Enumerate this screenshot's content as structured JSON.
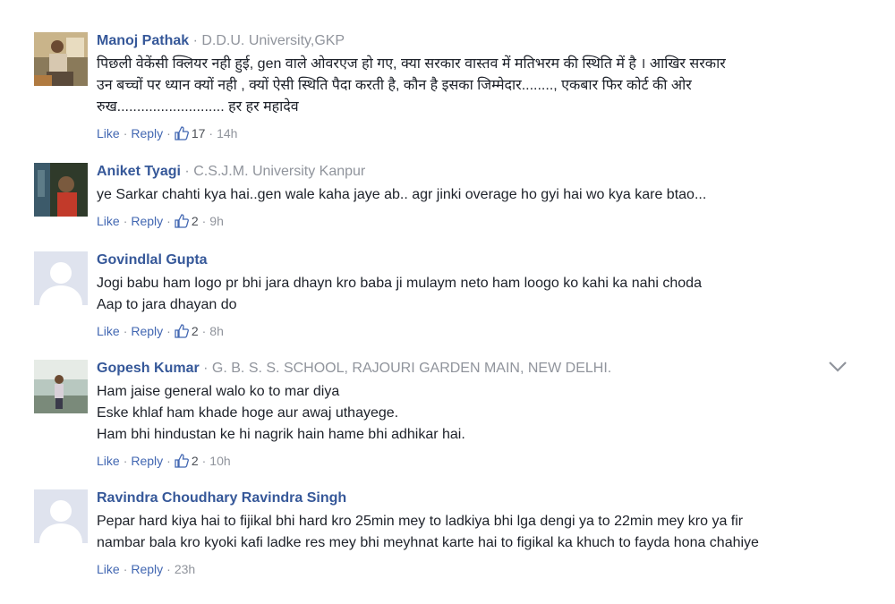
{
  "comments": [
    {
      "name": "Manoj Pathak",
      "subtitle": "D.D.U. University,GKP",
      "lines": [
        "पिछली वेकेंसी क्लियर नही हुई, gen वाले ओवरएज हो गए, क्या सरकार वास्तव में मतिभरम की स्थिति में है । आखिर सरकार",
        "उन बच्चों पर ध्यान क्यों नही , क्यों ऐसी स्थिति पैदा करती है, कौन है इसका जिम्मेदार........, एकबार फिर कोर्ट की ओर",
        "रुख........................... हर हर महादेव"
      ],
      "like": "Like",
      "reply": "Reply",
      "likes": "17",
      "time": "14h"
    },
    {
      "name": "Aniket Tyagi",
      "subtitle": "C.S.J.M. University Kanpur",
      "lines": [
        "ye Sarkar chahti kya hai..gen wale kaha jaye ab.. agr jinki overage ho gyi hai wo kya kare btao..."
      ],
      "like": "Like",
      "reply": "Reply",
      "likes": "2",
      "time": "9h"
    },
    {
      "name": "Govindlal Gupta",
      "subtitle": "",
      "lines": [
        "Jogi babu ham logo pr bhi jara dhayn kro baba ji mulaym neto ham loogo ko kahi ka nahi choda",
        "Aap to jara dhayan do"
      ],
      "like": "Like",
      "reply": "Reply",
      "likes": "2",
      "time": "8h"
    },
    {
      "name": "Gopesh Kumar",
      "subtitle": "G. B. S. S. SCHOOL, RAJOURI GARDEN MAIN, NEW DELHI.",
      "lines": [
        "Ham jaise general walo ko to mar diya",
        "Eske khlaf ham khade hoge aur awaj uthayege.",
        "Ham bhi hindustan ke hi nagrik hain hame bhi adhikar hai."
      ],
      "like": "Like",
      "reply": "Reply",
      "likes": "2",
      "time": "10h"
    },
    {
      "name": "Ravindra Choudhary Ravindra Singh",
      "subtitle": "",
      "lines": [
        "Pepar hard kiya hai to fijikal bhi hard kro 25min mey to ladkiya bhi lga dengi ya to 22min mey kro ya fir",
        "nambar bala kro kyoki kafi ladke res mey bhi meyhnat karte hai to figikal ka khuch to fayda hona chahiye"
      ],
      "like": "Like",
      "reply": "Reply",
      "likes": "",
      "time": "23h"
    }
  ],
  "separator": "·",
  "icons": {
    "like": "thumbs-up-icon",
    "menu": "chevron-down-icon",
    "avatar_default": "default-avatar-icon"
  },
  "colors": {
    "name": "#365899",
    "link": "#4267b2",
    "muted": "#90949c"
  }
}
